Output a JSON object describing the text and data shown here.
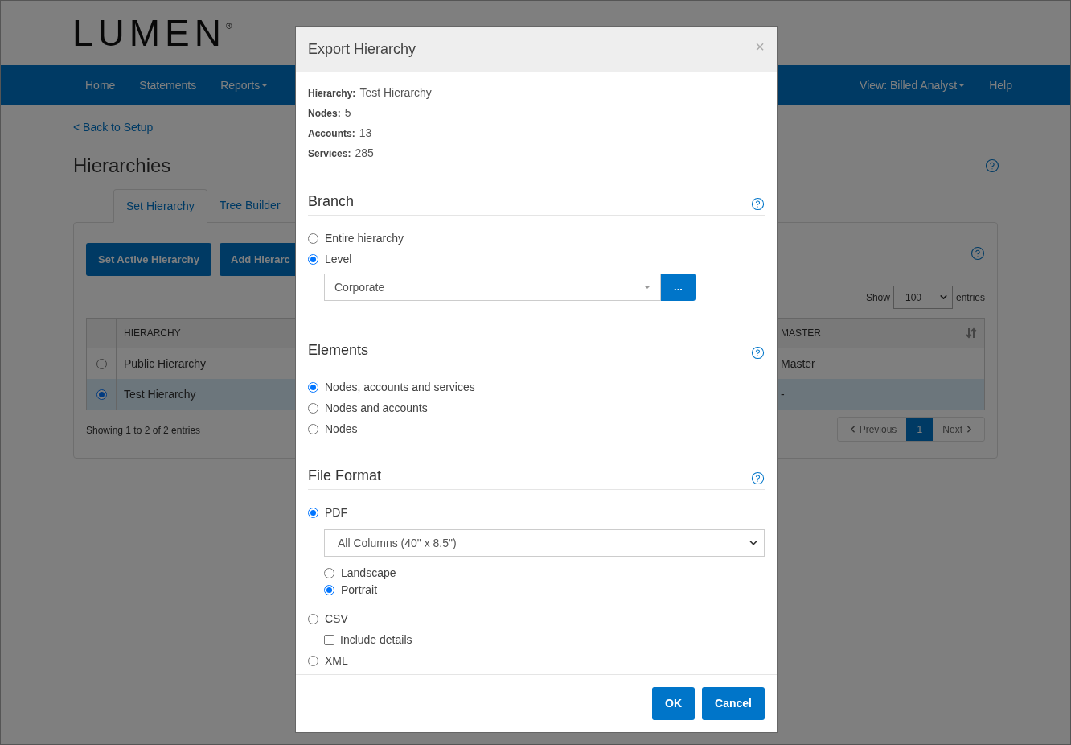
{
  "header": {
    "logo": "LUMEN",
    "logo_mark": "®"
  },
  "nav": {
    "items": [
      {
        "label": "Home",
        "dropdown": false
      },
      {
        "label": "Statements",
        "dropdown": false
      },
      {
        "label": "Reports",
        "dropdown": true
      }
    ],
    "right_items": [
      {
        "label": "View: Billed Analyst",
        "dropdown": true
      },
      {
        "label": "Help",
        "dropdown": false
      }
    ]
  },
  "back_link": "< Back to Setup",
  "page_title": "Hierarchies",
  "tabs": [
    {
      "label": "Set Hierarchy",
      "selected": true
    },
    {
      "label": "Tree Builder",
      "selected": false
    }
  ],
  "actions": [
    "Set Active Hierarchy",
    "Add Hierarc"
  ],
  "show_entries": {
    "before": "Show",
    "value": "100",
    "after": "entries"
  },
  "table": {
    "columns": [
      "HIERARCHY",
      "MASTER"
    ],
    "rows": [
      {
        "selected": false,
        "hierarchy": "Public Hierarchy",
        "master": "Master"
      },
      {
        "selected": true,
        "hierarchy": "Test Hierarchy",
        "master": "-"
      }
    ]
  },
  "table_info": "Showing 1 to 2 of 2 entries",
  "pagination": {
    "previous": "Previous",
    "pages": [
      {
        "label": "1",
        "selected": true
      }
    ],
    "next": "Next"
  },
  "modal": {
    "title": "Export Hierarchy",
    "close": "×",
    "info": [
      {
        "label": "Hierarchy:",
        "value": "Test Hierarchy"
      },
      {
        "label": "Nodes:",
        "value": "5"
      },
      {
        "label": "Accounts:",
        "value": "13"
      },
      {
        "label": "Services:",
        "value": "285"
      }
    ],
    "branch": {
      "title": "Branch",
      "options": [
        {
          "label": "Entire hierarchy",
          "selected": false
        },
        {
          "label": "Level",
          "selected": true
        }
      ],
      "level_value": "Corporate",
      "level_button": "..."
    },
    "elements": {
      "title": "Elements",
      "options": [
        {
          "label": "Nodes, accounts and services",
          "selected": true
        },
        {
          "label": "Nodes and accounts",
          "selected": false
        },
        {
          "label": "Nodes",
          "selected": false
        }
      ]
    },
    "file_format": {
      "title": "File Format",
      "options": [
        {
          "kind": "pdf",
          "label": "PDF",
          "selected": true,
          "select_value": "All Columns (40\" x 8.5\")",
          "orientations": [
            {
              "label": "Landscape",
              "selected": false
            },
            {
              "label": "Portrait",
              "selected": true
            }
          ]
        },
        {
          "kind": "csv",
          "label": "CSV",
          "selected": false,
          "checkbox": {
            "label": "Include details",
            "checked": false
          }
        },
        {
          "kind": "xml",
          "label": "XML",
          "selected": false
        }
      ]
    },
    "buttons": [
      "OK",
      "Cancel"
    ]
  }
}
